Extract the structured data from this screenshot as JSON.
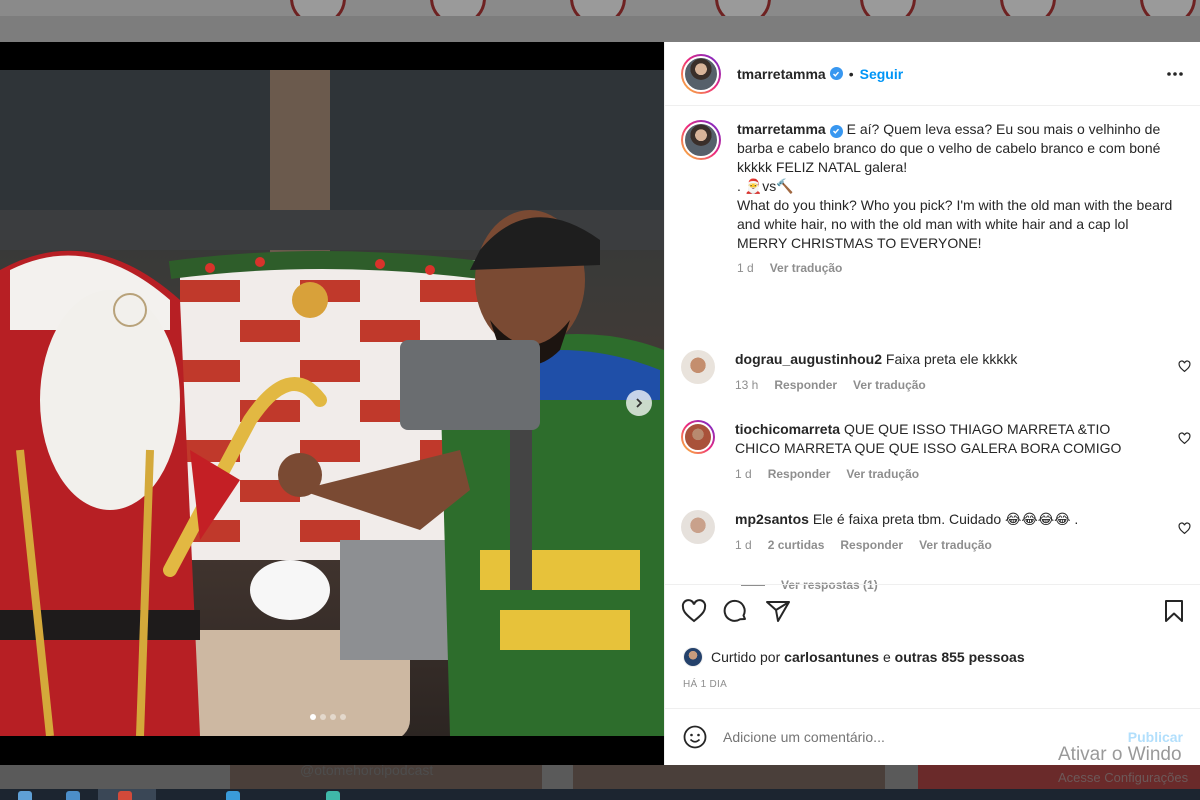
{
  "background": {
    "bottom_watermark": "@otomehoroipodcast"
  },
  "post": {
    "username": "tmarretamma",
    "follow_label": "Seguir",
    "follow_separator": "•",
    "media": {
      "slide_count": 4,
      "active_slide": 1
    },
    "caption": {
      "username": "tmarretamma",
      "text_pt": "E aí? Quem leva essa? Eu sou mais o velhinho de barba e cabelo branco do que o velho de cabelo branco e com boné kkkkk FELIZ NATAL galera!",
      "text_emoji_line": ". 🎅vs🔨",
      "text_en": "What do you think? Who you pick? I'm with the old man with the beard and white hair, no with the old man with white hair and a cap lol MERRY CHRISTMAS TO EVERYONE!",
      "time": "1 d",
      "translate": "Ver tradução"
    },
    "comments": [
      {
        "username": "dograu_augustinhou2",
        "text": "Faixa preta ele kkkkk",
        "time": "13 h",
        "likes": "",
        "reply": "Responder",
        "translate": "Ver tradução"
      },
      {
        "username": "tiochicomarreta",
        "text": "QUE QUE ISSO THIAGO MARRETA &TIO CHICO MARRETA QUE QUE ISSO GALERA BORA COMIGO",
        "time": "1 d",
        "likes": "",
        "reply": "Responder",
        "translate": "Ver tradução"
      },
      {
        "username": "mp2santos",
        "text": "Ele é faixa preta tbm. Cuidado 😂😂😂😂 .",
        "time": "1 d",
        "likes": "2 curtidas",
        "reply": "Responder",
        "translate": "Ver tradução"
      }
    ],
    "view_replies": "Ver respostas (1)",
    "likes": {
      "prefix": "Curtido por",
      "user": "carlosantunes",
      "connector": "e",
      "others": "outras 855 pessoas"
    },
    "date": "HÁ 1 DIA",
    "add_comment": {
      "placeholder": "Adicione um comentário...",
      "publish": "Publicar"
    }
  },
  "windows_watermark": {
    "line1": "Ativar o Windo",
    "line2": "Acesse Configurações"
  },
  "colors": {
    "link_blue": "#0095f6",
    "verified": "#3897f0",
    "muted": "#8e8e8e"
  }
}
